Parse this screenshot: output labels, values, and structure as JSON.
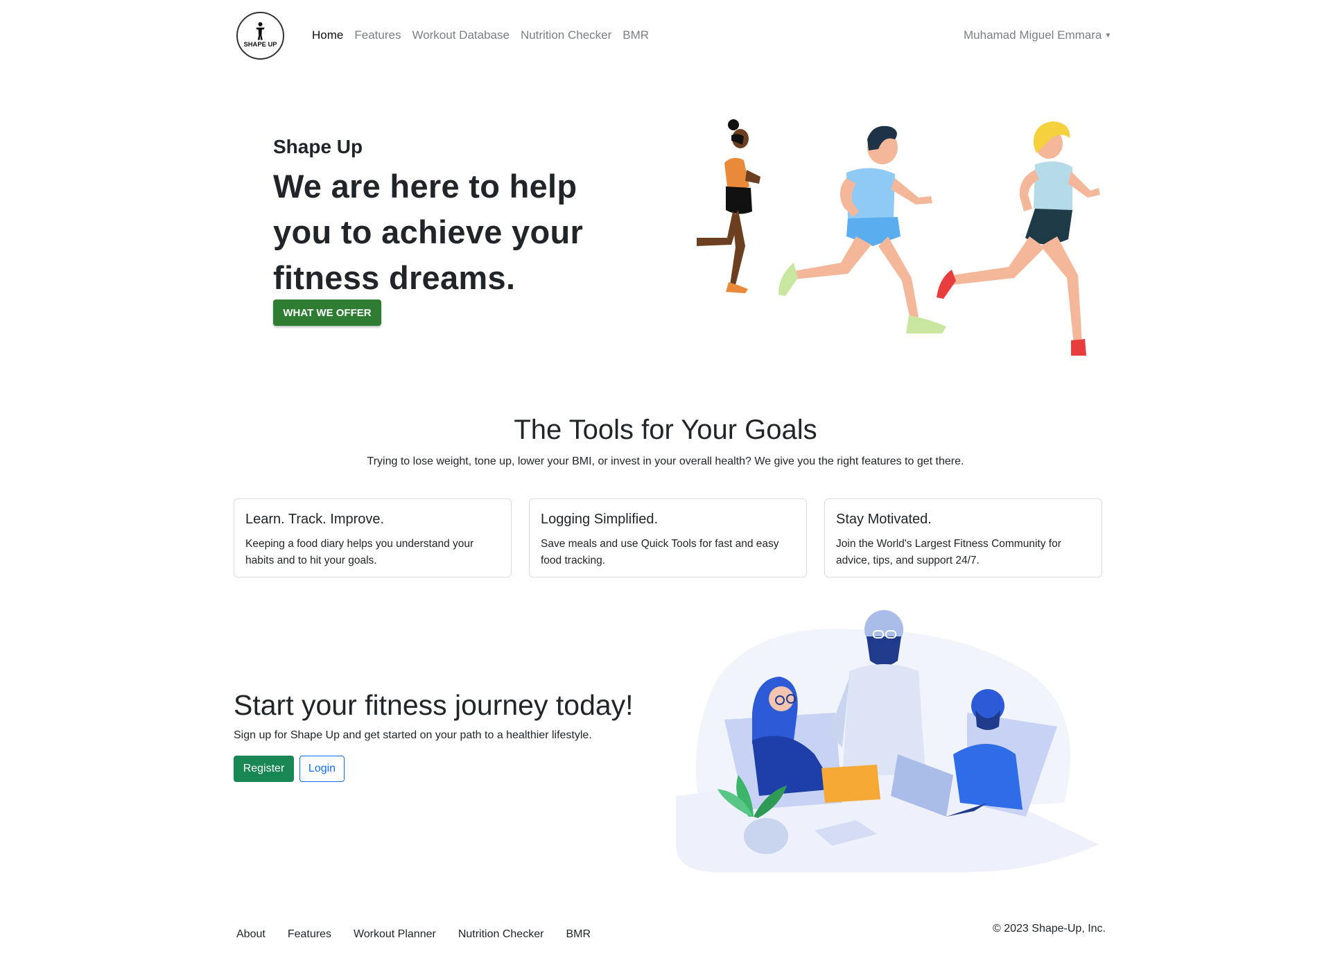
{
  "navbar": {
    "logo_text": "SHAPE UP",
    "links": [
      {
        "label": "Home",
        "active": true
      },
      {
        "label": "Features",
        "active": false
      },
      {
        "label": "Workout Database",
        "active": false
      },
      {
        "label": "Nutrition Checker",
        "active": false
      },
      {
        "label": "BMR",
        "active": false
      }
    ],
    "user_name": "Muhamad Miguel Emmara"
  },
  "hero": {
    "brand": "Shape Up",
    "headline": "We are here to help you to achieve your fitness dreams.",
    "button_label": "WHAT WE OFFER",
    "illustration": "runners-illustration"
  },
  "tools": {
    "title": "The Tools for Your Goals",
    "subtitle": "Trying to lose weight, tone up, lower your BMI, or invest in your overall health? We give you the right features to get there.",
    "cards": [
      {
        "title": "Learn. Track. Improve.",
        "text": "Keeping a food diary helps you understand your habits and to hit your goals."
      },
      {
        "title": "Logging Simplified.",
        "text": "Save meals and use Quick Tools for fast and easy food tracking."
      },
      {
        "title": "Stay Motivated.",
        "text": "Join the World's Largest Fitness Community for advice, tips, and support 24/7."
      }
    ]
  },
  "cta": {
    "title": "Start your fitness journey today!",
    "subtitle": "Sign up for Shape Up and get started on your path to a healthier lifestyle.",
    "register_label": "Register",
    "login_label": "Login",
    "illustration": "team-meeting-illustration"
  },
  "footer": {
    "links": [
      "About",
      "Features",
      "Workout Planner",
      "Nutrition Checker",
      "BMR"
    ],
    "copyright": "© 2023 Shape-Up, Inc."
  },
  "colors": {
    "primary_green": "#2e7d32",
    "register_green": "#198754",
    "login_blue": "#0d6efd",
    "nav_muted": "#7a7f85"
  }
}
